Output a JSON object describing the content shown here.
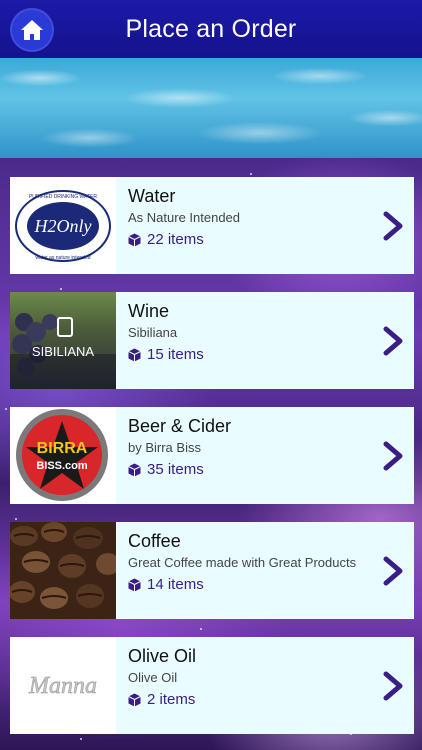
{
  "header": {
    "title": "Place an Order"
  },
  "categories": [
    {
      "title": "Water",
      "subtitle": "As Nature Intended",
      "count": "22 items",
      "logo_text": "H2Only",
      "logo_ring_top": "PURIFIED DRINKING WATER",
      "logo_ring_bottom": "water as nature intended"
    },
    {
      "title": "Wine",
      "subtitle": "Sibiliana",
      "count": "15 items",
      "logo_text": "SIBILIANA"
    },
    {
      "title": "Beer & Cider",
      "subtitle": "by Birra Biss",
      "count": "35 items",
      "logo_text_1": "BIRRA",
      "logo_text_2": "BISS.com"
    },
    {
      "title": "Coffee",
      "subtitle": "Great Coffee made with Great Products",
      "count": "14 items"
    },
    {
      "title": "Olive Oil",
      "subtitle": "Olive Oil",
      "count": "2 items",
      "logo_text": "Manna"
    }
  ],
  "colors": {
    "header": "#1c1aa8",
    "card_bg": "#e9fcff",
    "accent": "#3a1d86"
  },
  "icons": {
    "home": "home-icon",
    "count": "cube-icon",
    "chevron": "chevron-right-icon"
  }
}
